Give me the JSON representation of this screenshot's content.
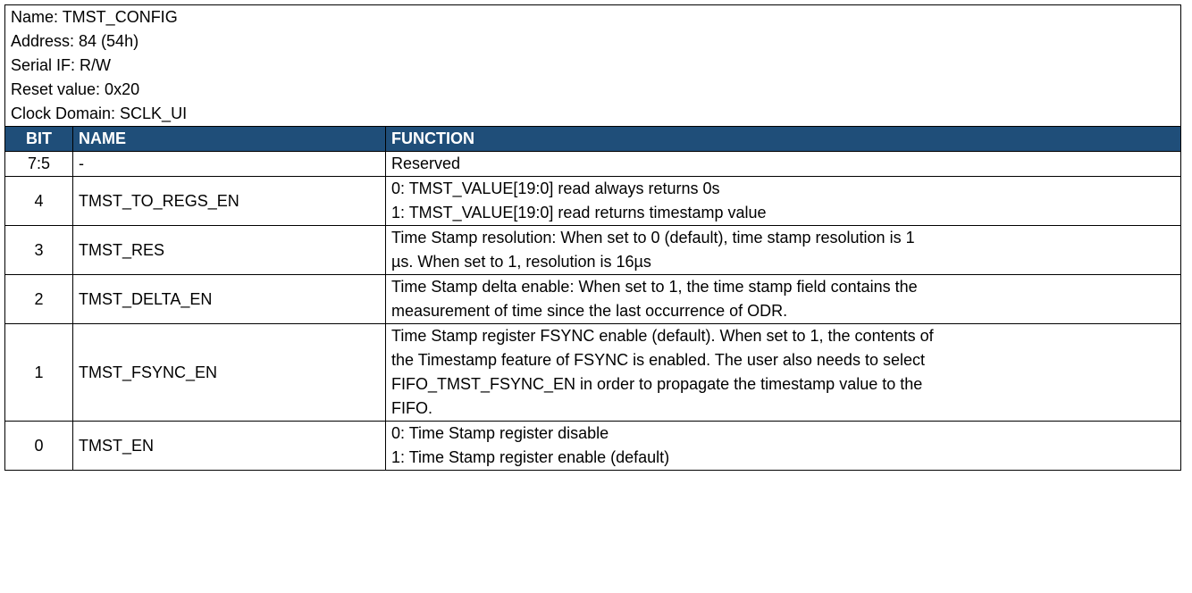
{
  "register": {
    "name_line": "Name: TMST_CONFIG",
    "address_line": "Address: 84 (54h)",
    "serial_if_line": "Serial IF: R/W",
    "reset_value_line": "Reset value: 0x20",
    "clock_domain_line": "Clock Domain: SCLK_UI"
  },
  "header": {
    "bit": "BIT",
    "name": "NAME",
    "function": "FUNCTION",
    "background_color": "#1f4e79"
  },
  "rows": [
    {
      "bit": "7:5",
      "name": "-",
      "function": [
        "Reserved"
      ]
    },
    {
      "bit": "4",
      "name": "TMST_TO_REGS_EN",
      "function": [
        "0: TMST_VALUE[19:0] read always returns 0s",
        "1: TMST_VALUE[19:0] read returns timestamp value"
      ]
    },
    {
      "bit": "3",
      "name": "TMST_RES",
      "function": [
        "Time Stamp resolution: When set to 0 (default), time stamp resolution is 1",
        "µs. When set to 1, resolution is 16µs"
      ]
    },
    {
      "bit": "2",
      "name": "TMST_DELTA_EN",
      "function": [
        "Time Stamp delta enable: When set to 1, the time stamp field contains the",
        "measurement of time since  the last occurrence of ODR."
      ]
    },
    {
      "bit": "1",
      "name": "TMST_FSYNC_EN",
      "function": [
        "Time Stamp register FSYNC enable (default). When set to 1, the contents of",
        "the Timestamp feature of FSYNC is enabled. The user also needs to select",
        "FIFO_TMST_FSYNC_EN in order to propagate the timestamp value to the",
        "FIFO."
      ]
    },
    {
      "bit": "0",
      "name": "TMST_EN",
      "function": [
        "0: Time Stamp register disable",
        "1: Time Stamp register enable (default)"
      ]
    }
  ]
}
